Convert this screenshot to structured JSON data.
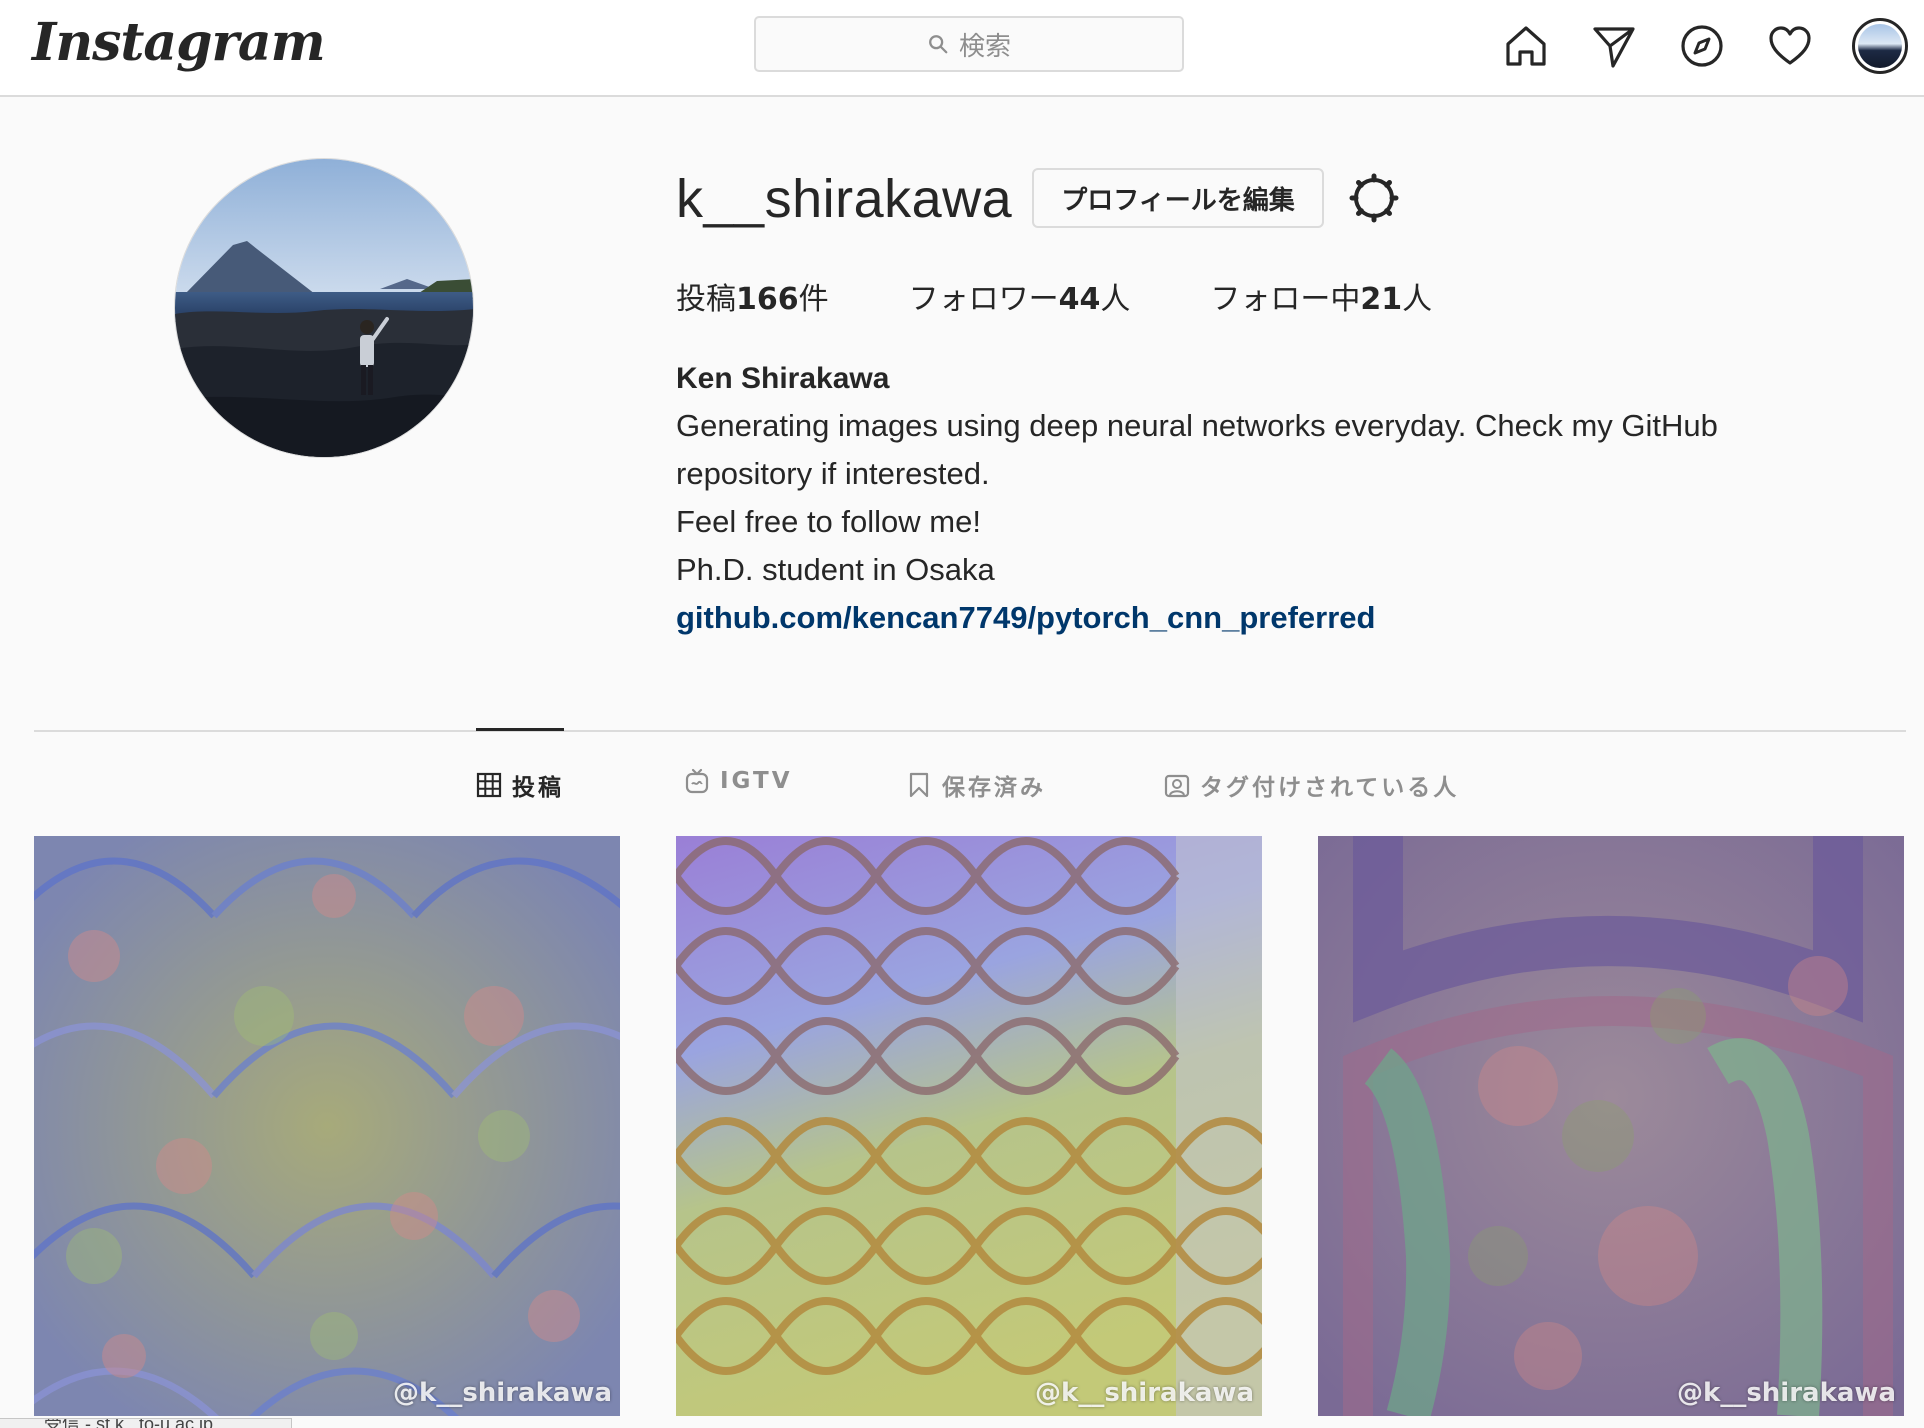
{
  "topbar": {
    "logo": "Instagram",
    "search_placeholder": "検索",
    "icons": [
      "home-icon",
      "direct-icon",
      "explore-icon",
      "activity-icon",
      "profile-avatar"
    ]
  },
  "profile": {
    "username": "k__shirakawa",
    "edit_label": "プロフィールを編集",
    "stats": {
      "posts_prefix": "投稿",
      "posts_count": "166",
      "posts_suffix": "件",
      "followers_prefix": "フォロワー",
      "followers_count": "44",
      "followers_suffix": "人",
      "following_prefix": "フォロー中",
      "following_count": "21",
      "following_suffix": "人"
    },
    "full_name": "Ken Shirakawa",
    "bio_lines": [
      "Generating images using deep neural networks everyday. Check my GitHub",
      "repository if interested.",
      "Feel free to follow me!",
      "Ph.D. student in Osaka"
    ],
    "link": "github.com/kencan7749/pytorch_cnn_preferred"
  },
  "tabs": [
    {
      "label": "投稿",
      "active": true
    },
    {
      "label": "IGTV",
      "active": false
    },
    {
      "label": "保存済み",
      "active": false
    },
    {
      "label": "タグ付けされている人",
      "active": false
    }
  ],
  "posts": [
    {
      "watermark": "@k__shirakawa"
    },
    {
      "watermark": "@k__shirakawa"
    },
    {
      "watermark": "@k__shirakawa"
    }
  ],
  "statusbar": {
    "text": "受信 - st.k...to-u.ac.jp"
  },
  "colors": {
    "link": "#00376b",
    "text": "#262626",
    "muted": "#8e8e8e",
    "border": "#dbdbdb",
    "background": "#fafafa"
  }
}
